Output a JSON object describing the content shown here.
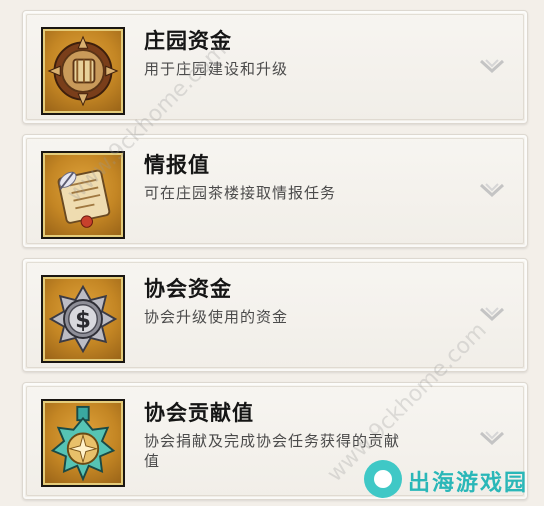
{
  "items": [
    {
      "title": "庄园资金",
      "desc": "用于庄园建设和升级",
      "icon": "estate-funds-coin-icon"
    },
    {
      "title": "情报值",
      "desc": "可在庄园茶楼接取情报任务",
      "icon": "intel-scroll-icon"
    },
    {
      "title": "协会资金",
      "desc": "协会升级使用的资金",
      "icon": "guild-funds-dollar-icon"
    },
    {
      "title": "协会贡献值",
      "desc": "协会捐献及完成协会任务获得的贡献值",
      "icon": "guild-contribution-medal-icon"
    }
  ],
  "watermark": {
    "text": "www.9ckhome.com"
  },
  "logo": {
    "text": "出海游戏园"
  },
  "colors": {
    "accent": "#2ab7b8",
    "icon_bg": "#c48624",
    "card_bg": "#f5f2ec"
  }
}
